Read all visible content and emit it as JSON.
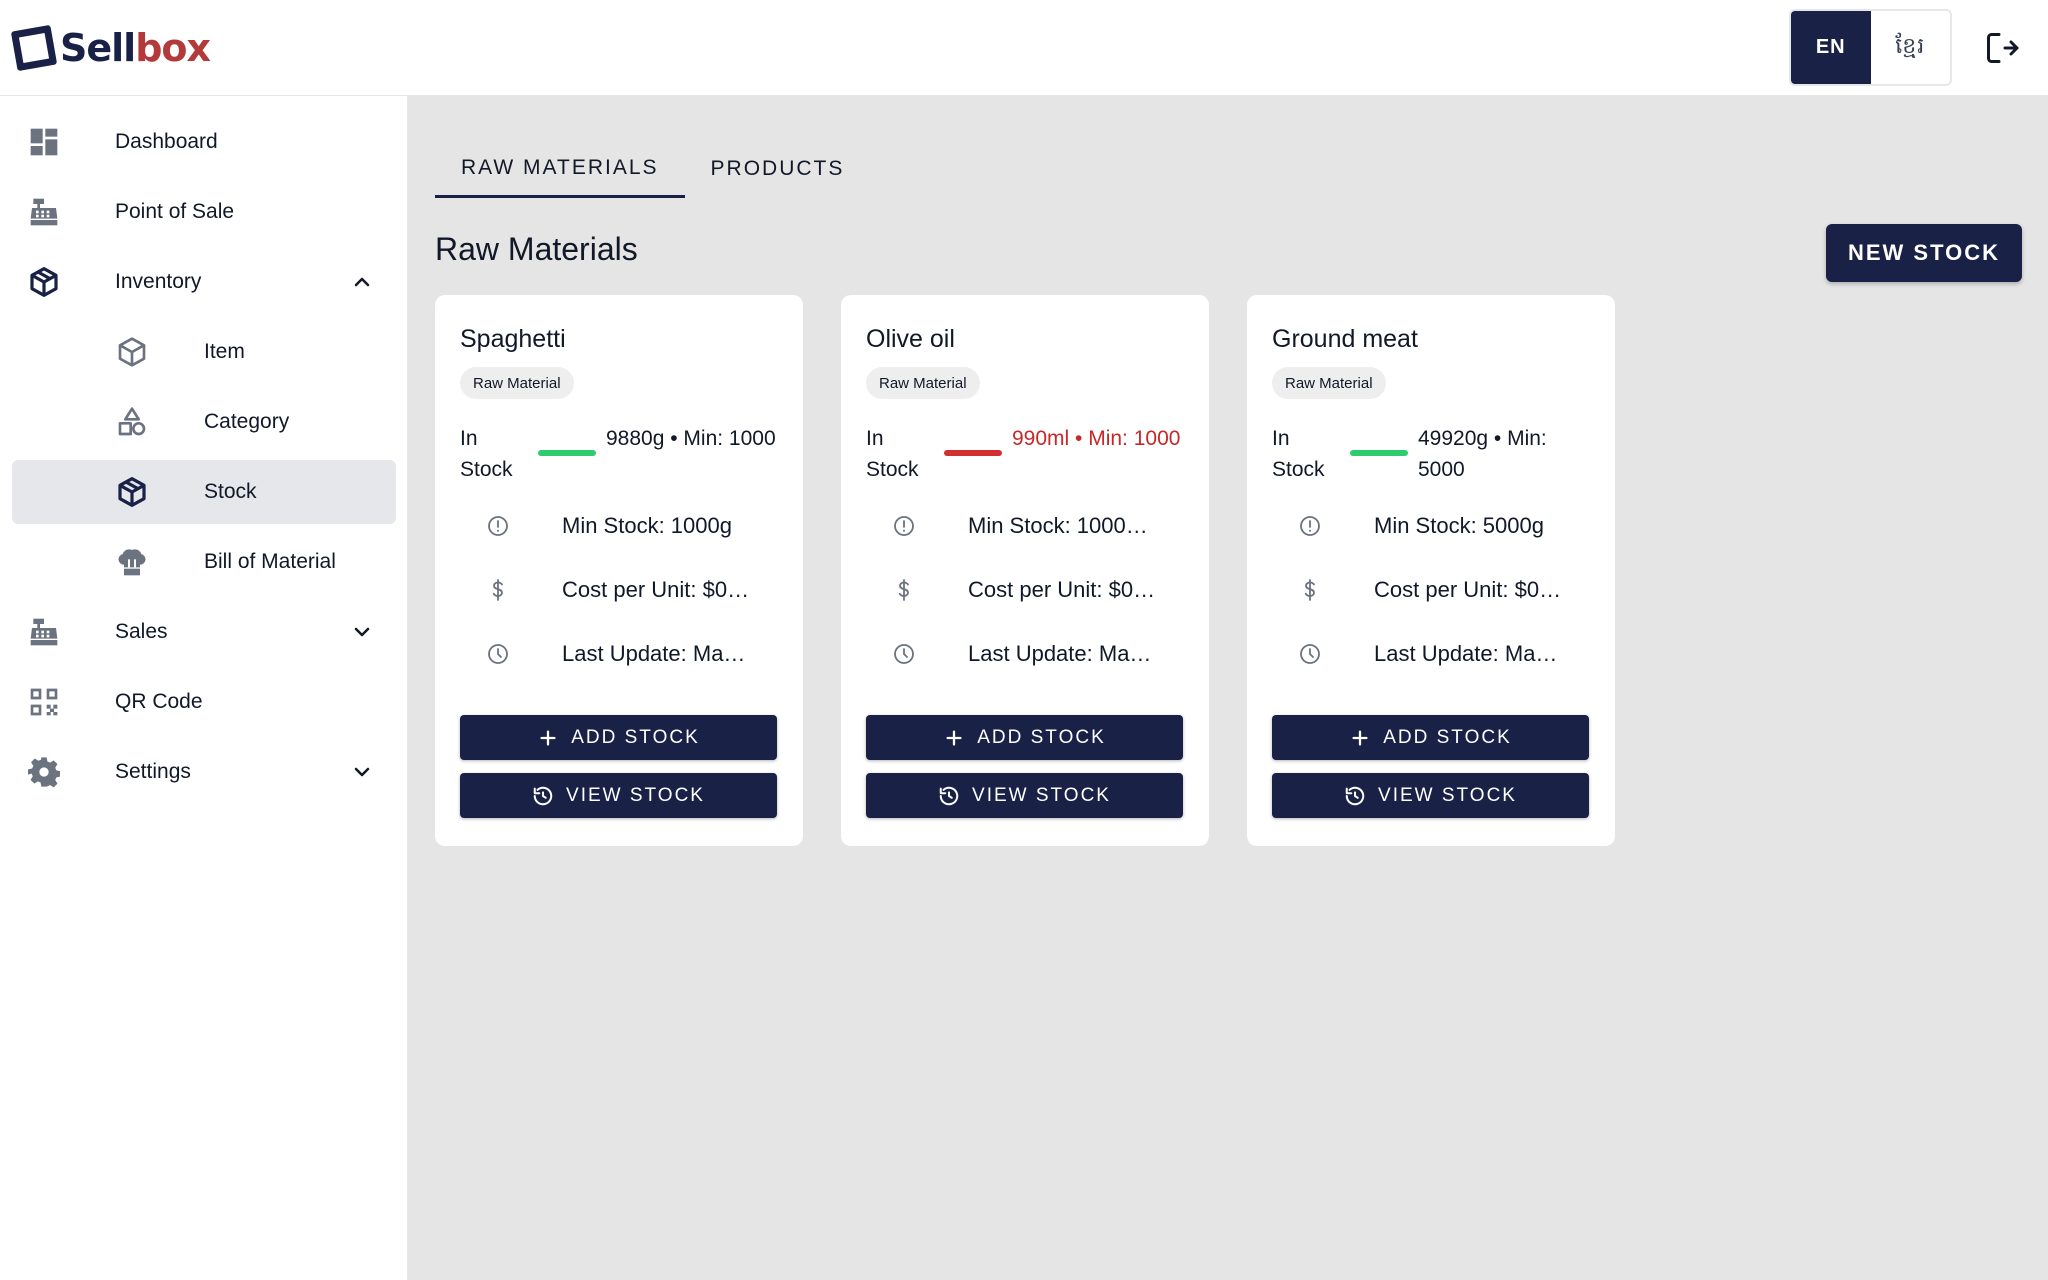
{
  "header": {
    "logo_sell": "Sell",
    "logo_box": "box",
    "lang_en": "EN",
    "lang_km": "ខ្មែរ"
  },
  "sidebar": {
    "items": [
      {
        "label": "Dashboard",
        "icon": "dashboard-icon"
      },
      {
        "label": "Point of Sale",
        "icon": "cash-register-icon"
      },
      {
        "label": "Inventory",
        "icon": "cube-icon",
        "expanded": true
      },
      {
        "label": "Item",
        "icon": "cube-outline-icon"
      },
      {
        "label": "Category",
        "icon": "shapes-icon"
      },
      {
        "label": "Stock",
        "icon": "cube-icon",
        "active": true
      },
      {
        "label": "Bill of Material",
        "icon": "chef-hat-icon"
      },
      {
        "label": "Sales",
        "icon": "cash-register-icon"
      },
      {
        "label": "QR Code",
        "icon": "qr-code-icon"
      },
      {
        "label": "Settings",
        "icon": "gear-icon"
      }
    ]
  },
  "tabs": [
    "RAW MATERIALS",
    "PRODUCTS"
  ],
  "section_title": "Raw Materials",
  "new_stock_label": "NEW STOCK",
  "colors": {
    "primary": "#1a2147",
    "ok": "#2ecc71",
    "low": "#d32f2f",
    "brand_red": "#b23a3a"
  },
  "cards": [
    {
      "name": "Spaghetti",
      "chip": "Raw Material",
      "in_stock": "In Stock",
      "qty": "9880g • Min: 1000",
      "status": "ok",
      "min_stock": "Min Stock: 1000g",
      "cost": "Cost per Unit: $0…",
      "last_update": "Last Update: Ma…",
      "add_label": "ADD STOCK",
      "view_label": "VIEW STOCK"
    },
    {
      "name": "Olive oil",
      "chip": "Raw Material",
      "in_stock": "In Stock",
      "qty": "990ml • Min: 1000",
      "status": "low",
      "min_stock": "Min Stock: 1000…",
      "cost": "Cost per Unit: $0…",
      "last_update": "Last Update: Ma…",
      "add_label": "ADD STOCK",
      "view_label": "VIEW STOCK"
    },
    {
      "name": "Ground meat",
      "chip": "Raw Material",
      "in_stock": "In Stock",
      "qty": "49920g • Min: 5000",
      "status": "ok",
      "min_stock": "Min Stock: 5000g",
      "cost": "Cost per Unit: $0…",
      "last_update": "Last Update: Ma…",
      "add_label": "ADD STOCK",
      "view_label": "VIEW STOCK"
    }
  ]
}
